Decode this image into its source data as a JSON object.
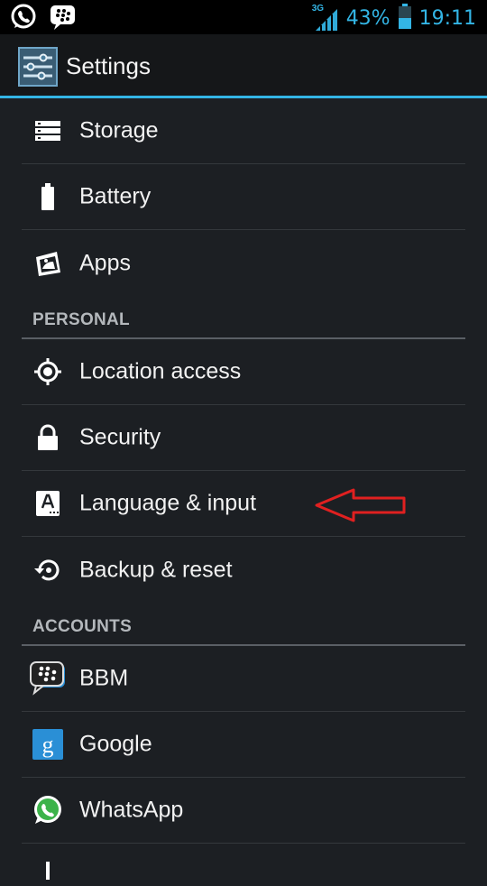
{
  "status_bar": {
    "network_label": "3G",
    "battery_percent": "43%",
    "time": "19:11",
    "notification_icons": [
      "whatsapp-icon",
      "bbm-icon"
    ],
    "accent_color": "#33b5e5"
  },
  "action_bar": {
    "title": "Settings",
    "icon": "settings-sliders-icon"
  },
  "sections": {
    "personal_header": "PERSONAL",
    "accounts_header": "ACCOUNTS"
  },
  "items": {
    "storage": {
      "label": "Storage",
      "icon": "storage-icon"
    },
    "battery": {
      "label": "Battery",
      "icon": "battery-icon"
    },
    "apps": {
      "label": "Apps",
      "icon": "apps-icon"
    },
    "location": {
      "label": "Location access",
      "icon": "location-icon"
    },
    "security": {
      "label": "Security",
      "icon": "lock-icon"
    },
    "language": {
      "label": "Language & input",
      "icon": "keyboard-language-icon"
    },
    "backup": {
      "label": "Backup & reset",
      "icon": "backup-restore-icon"
    },
    "bbm": {
      "label": "BBM",
      "icon": "bbm-icon"
    },
    "google": {
      "label": "Google",
      "icon": "google-icon"
    },
    "whatsapp": {
      "label": "WhatsApp",
      "icon": "whatsapp-icon"
    }
  },
  "annotation": {
    "icon": "red-arrow-icon",
    "color": "#e02020"
  }
}
